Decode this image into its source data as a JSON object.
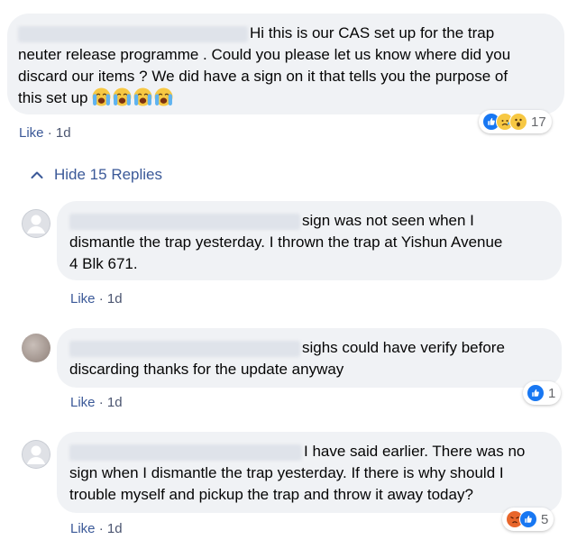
{
  "comment": {
    "author_hidden": "",
    "text_line1": "Hi this is our CAS set up for the trap",
    "text_line2": "neuter release programme . Could you please let us know where did you",
    "text_line3": "discard our items ? We did have a sign on it that tells you the purpose of",
    "text_line4": "this set up",
    "crying_emojis": [
      "crying-face",
      "crying-face",
      "crying-face",
      "crying-face"
    ],
    "like_label": "Like",
    "time": "1d",
    "reactions": [
      "like-icon",
      "sad-icon",
      "wow-icon"
    ],
    "reaction_count": "17"
  },
  "replies_toggle": {
    "label": "Hide 15 Replies"
  },
  "replies": [
    {
      "line1": "sign was not seen when I",
      "line2": "dismantle the trap yesterday. I thrown the trap at Yishun Avenue",
      "line3": "4 Blk 671.",
      "like_label": "Like",
      "time": "1d"
    },
    {
      "line1": "sighs could have verify before",
      "line2": "discarding thanks for the update anyway",
      "like_label": "Like",
      "time": "1d",
      "reactions": [
        "like-icon"
      ],
      "reaction_count": "1"
    },
    {
      "line1": "I have said earlier. There was no",
      "line2": "sign when I dismantle the trap yesterday. If there is why should I",
      "line3": "trouble myself and pickup the trap and throw it away today?",
      "like_label": "Like",
      "time": "1d",
      "reactions": [
        "angry-icon",
        "like-icon"
      ],
      "reaction_count": "5"
    }
  ],
  "colors": {
    "bubble": "#f0f2f5",
    "link": "#3b5998",
    "like_blue": "#1877f2",
    "meta_text": "#4b5570"
  }
}
